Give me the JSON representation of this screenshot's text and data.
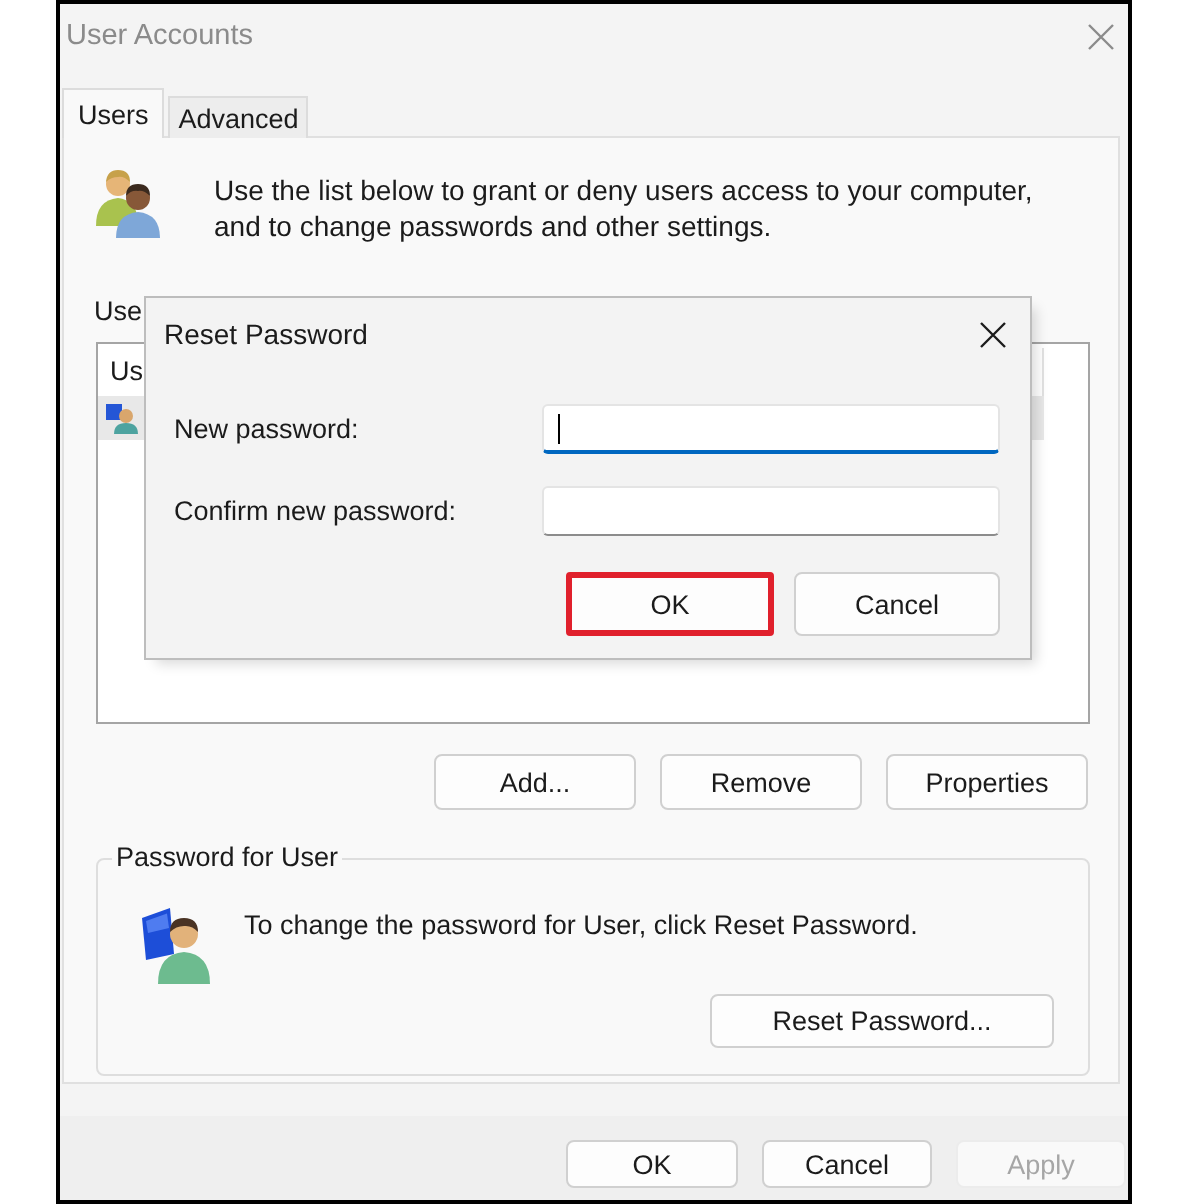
{
  "window": {
    "title": "User Accounts",
    "active": false
  },
  "tabs": [
    {
      "label": "Users",
      "selected": true
    },
    {
      "label": "Advanced",
      "selected": false
    }
  ],
  "intro": {
    "text": "Use the list below to grant or deny users access to your computer, and to change passwords and other settings."
  },
  "users_list": {
    "label": "Use",
    "columns": [
      "Us"
    ],
    "rows": [
      {
        "selected": true
      }
    ]
  },
  "list_buttons": [
    {
      "label": "Add..."
    },
    {
      "label": "Remove"
    },
    {
      "label": "Properties"
    }
  ],
  "password_group": {
    "title": "Password for User",
    "text": "To change the password for User, click Reset Password.",
    "button": "Reset Password..."
  },
  "footer_buttons": [
    {
      "label": "OK",
      "disabled": false
    },
    {
      "label": "Cancel",
      "disabled": false
    },
    {
      "label": "Apply",
      "disabled": true
    }
  ],
  "reset_dialog": {
    "title": "Reset Password",
    "fields": [
      {
        "label": "New password:",
        "focused": true
      },
      {
        "label": "Confirm new password:",
        "focused": false
      }
    ],
    "buttons": [
      {
        "label": "OK",
        "highlighted": true
      },
      {
        "label": "Cancel",
        "highlighted": false
      }
    ]
  }
}
